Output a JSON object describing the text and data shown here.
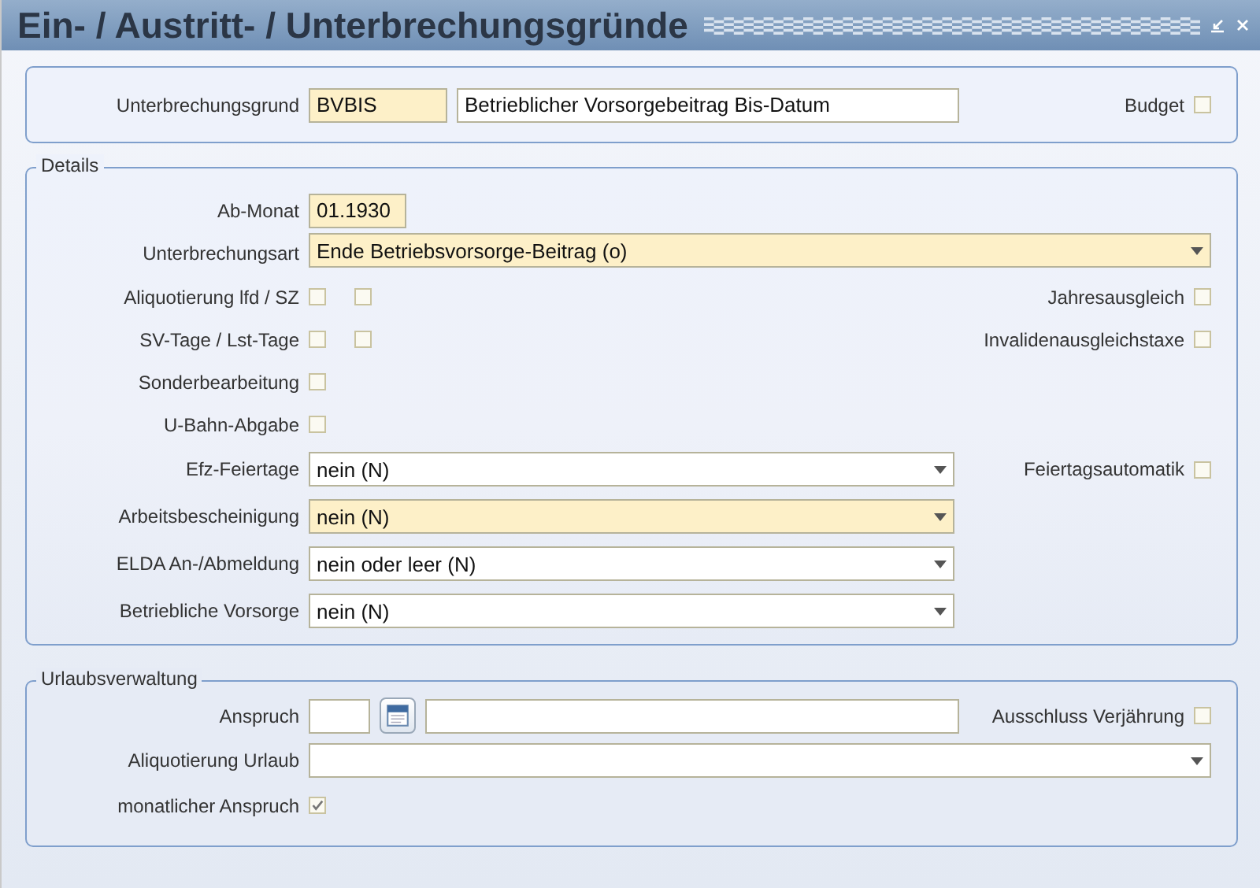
{
  "window": {
    "title": "Ein- / Austritt- / Unterbrechungsgründe"
  },
  "header": {
    "rows": [
      {
        "label": "Unterbrechungsgrund",
        "controls": [
          {
            "kind": "short-input",
            "value": "BVBIS",
            "required": true
          },
          {
            "kind": "input",
            "value": "Betrieblicher Vorsorgebeitrag Bis-Datum",
            "required": false
          }
        ],
        "right": {
          "label": "Budget",
          "checked": false
        }
      }
    ]
  },
  "details": {
    "title": "Details",
    "rows": [
      {
        "label": "Ab-Monat",
        "controls": [
          {
            "kind": "short-input",
            "value": "01.1930",
            "required": true
          }
        ]
      },
      {
        "label": "Unterbrechungsart",
        "controls": [
          {
            "kind": "wide-select",
            "value": "Ende Betriebsvorsorge-Beitrag (o)",
            "required": true
          }
        ]
      },
      {
        "label": "Aliquotierung lfd / SZ",
        "controls": [
          {
            "kind": "checkbox",
            "checked": false
          },
          {
            "kind": "checkbox",
            "checked": false
          }
        ],
        "right": {
          "label": "Jahresausgleich",
          "checked": false
        }
      },
      {
        "label": "SV-Tage / Lst-Tage",
        "controls": [
          {
            "kind": "checkbox",
            "checked": false
          },
          {
            "kind": "checkbox",
            "checked": false
          }
        ],
        "right": {
          "label": "Invalidenausgleichstaxe",
          "checked": false
        }
      },
      {
        "label": "Sonderbearbeitung",
        "controls": [
          {
            "kind": "checkbox",
            "checked": false
          }
        ]
      },
      {
        "label": "U-Bahn-Abgabe",
        "controls": [
          {
            "kind": "checkbox",
            "checked": false
          }
        ]
      },
      {
        "label": "Efz-Feiertage",
        "controls": [
          {
            "kind": "select",
            "value": "nein (N)",
            "required": false
          }
        ],
        "right": {
          "label": "Feiertagsautomatik",
          "checked": false
        }
      },
      {
        "label": "Arbeitsbescheinigung",
        "controls": [
          {
            "kind": "select",
            "value": "nein (N)",
            "required": true
          }
        ]
      },
      {
        "label": "ELDA An-/Abmeldung",
        "controls": [
          {
            "kind": "select",
            "value": "nein oder leer (N)",
            "required": false
          }
        ]
      },
      {
        "label": "Betriebliche Vorsorge",
        "controls": [
          {
            "kind": "select",
            "value": "nein (N)",
            "required": false
          }
        ]
      }
    ]
  },
  "vacation": {
    "title": "Urlaubsverwaltung",
    "rows": [
      {
        "label": "Anspruch",
        "controls": [
          {
            "kind": "tiny-input",
            "required": false
          },
          {
            "kind": "calendar-button"
          },
          {
            "kind": "input",
            "required": false
          }
        ],
        "right": {
          "label": "Ausschluss Verjährung",
          "checked": false
        }
      },
      {
        "label": "Aliquotierung Urlaub",
        "controls": [
          {
            "kind": "wide-select",
            "required": false
          }
        ]
      },
      {
        "label": "monatlicher Anspruch",
        "controls": [
          {
            "kind": "checkbox",
            "checked": true
          }
        ]
      }
    ]
  }
}
